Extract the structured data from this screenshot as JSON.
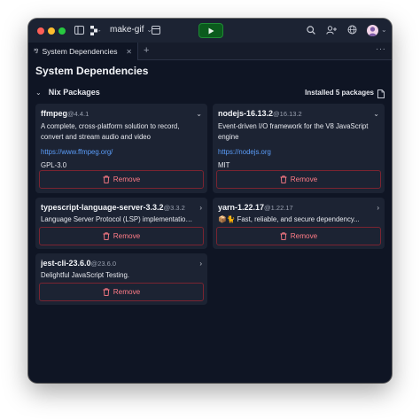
{
  "window": {
    "repl_name": "make-gif",
    "colors": {
      "accent_run": "#1f8a35",
      "link": "#5a9cf8",
      "danger": "#ff7b86"
    }
  },
  "tabs": [
    {
      "label": "System Dependencies",
      "icon": "nix-icon"
    }
  ],
  "page": {
    "title": "System Dependencies"
  },
  "section": {
    "title": "Nix Packages",
    "installed_label": "Installed 5 packages"
  },
  "packages": [
    {
      "name": "ffmpeg",
      "version": "@4.4.1",
      "description": "A complete, cross-platform solution to record, convert and stream audio and video",
      "link": "https://www.ffmpeg.org/",
      "license": "GPL-3.0",
      "remove_label": "Remove"
    },
    {
      "name": "nodejs-16.13.2",
      "version": "@16.13.2",
      "description": "Event-driven I/O framework for the V8 JavaScript engine",
      "link": "https://nodejs.org",
      "license": "MIT",
      "remove_label": "Remove"
    },
    {
      "name": "typescript-language-server-3.3.2",
      "version": "@3.3.2",
      "description": "Language Server Protocol (LSP) implementation f...",
      "remove_label": "Remove"
    },
    {
      "name": "yarn-1.22.17",
      "version": "@1.22.17",
      "description": "📦🐈 Fast, reliable, and secure dependency...",
      "remove_label": "Remove"
    },
    {
      "name": "jest-cli-23.6.0",
      "version": "@23.6.0",
      "description": "Delightful JavaScript Testing.",
      "remove_label": "Remove"
    }
  ]
}
